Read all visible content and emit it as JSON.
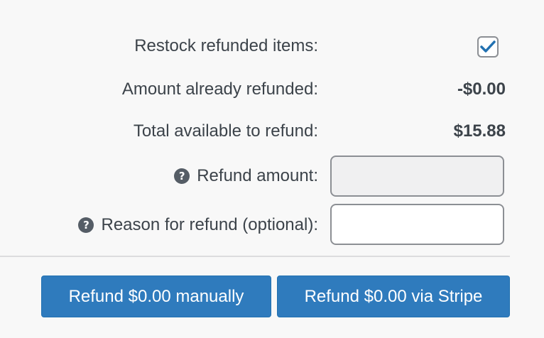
{
  "refund_panel": {
    "restock": {
      "label": "Restock refunded items:",
      "checked": true
    },
    "already_refunded": {
      "label": "Amount already refunded:",
      "value": "-$0.00"
    },
    "available": {
      "label": "Total available to refund:",
      "value": "$15.88"
    },
    "refund_amount": {
      "label": "Refund amount:",
      "value": "",
      "help_glyph": "?"
    },
    "reason": {
      "label": "Reason for refund (optional):",
      "value": "",
      "help_glyph": "?"
    }
  },
  "actions": {
    "manual_label": "Refund $0.00 manually",
    "stripe_label": "Refund $0.00 via Stripe"
  },
  "icons": {
    "help": "question-circle-icon",
    "check": "checkmark-icon"
  },
  "colors": {
    "primary_button": "#2f7bbd",
    "checkmark": "#2271b1",
    "text": "#3c434a",
    "help_icon_bg": "#555d66"
  }
}
